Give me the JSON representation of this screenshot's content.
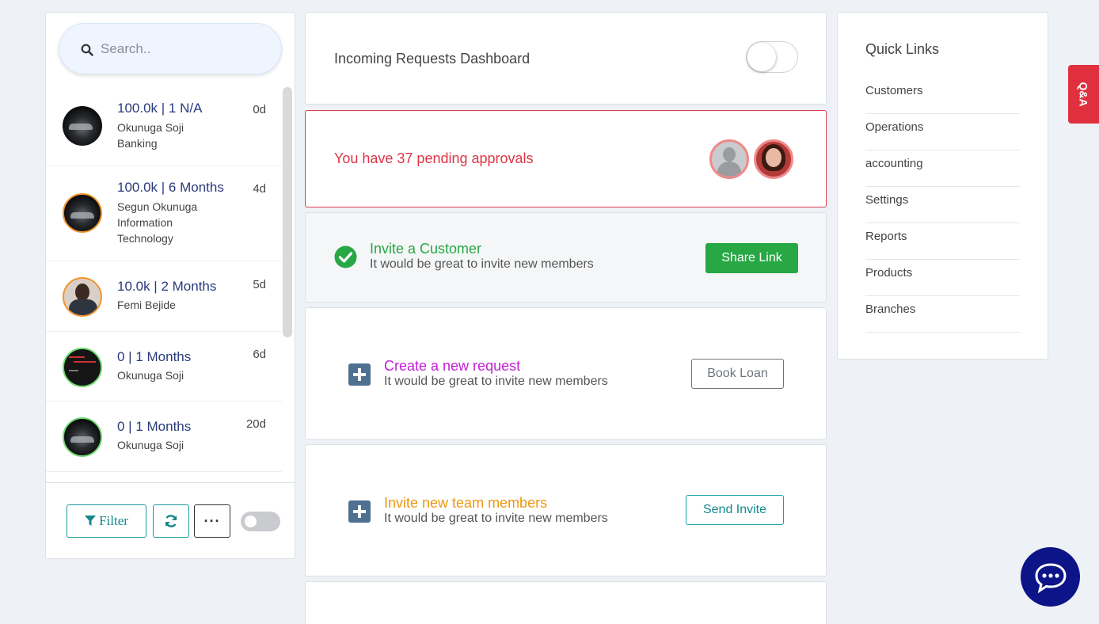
{
  "search": {
    "placeholder": "Search.."
  },
  "requests": [
    {
      "title": "100.0k | 1 N/A",
      "sub": "Okunuga Soji Banking",
      "days": "0d",
      "ring": "none",
      "avatar": "car"
    },
    {
      "title": "100.0k | 6 Months",
      "sub": "Segun Okunuga Information Technology",
      "days": "4d",
      "ring": "orange",
      "avatar": "car"
    },
    {
      "title": "10.0k | 2 Months",
      "sub": "Femi Bejide",
      "days": "5d",
      "ring": "orange",
      "avatar": "person"
    },
    {
      "title": "0 | 1 Months",
      "sub": "Okunuga Soji",
      "days": "6d",
      "ring": "green",
      "avatar": "terminal"
    },
    {
      "title": "0 | 1 Months",
      "sub": "Okunuga Soji",
      "days": "20d",
      "ring": "green",
      "avatar": "car"
    }
  ],
  "footer": {
    "filter_label": "Filter"
  },
  "dashboard": {
    "title": "Incoming Requests Dashboard"
  },
  "pending": {
    "text": "You have 37 pending approvals"
  },
  "invite_customer": {
    "title": "Invite a Customer",
    "subtitle": "It would be great to invite new members",
    "button": "Share Link"
  },
  "new_request": {
    "title": "Create a new request",
    "subtitle": "It would be great to invite new members",
    "button": "Book Loan",
    "title_color": "#c21fd6"
  },
  "team_members": {
    "title": "Invite new team members",
    "subtitle": "It would be great to invite new members",
    "button": "Send Invite",
    "title_color": "#f0960e"
  },
  "quick_links": {
    "title": "Quick Links",
    "items": [
      "Customers",
      "Operations",
      "accounting",
      "Settings",
      "Reports",
      "Products",
      "Branches"
    ]
  },
  "qa_tab": "Q&A",
  "colors": {
    "accent_teal": "#17a2a8",
    "success": "#28a745",
    "danger": "#dc3545",
    "chat": "#0c1488"
  }
}
